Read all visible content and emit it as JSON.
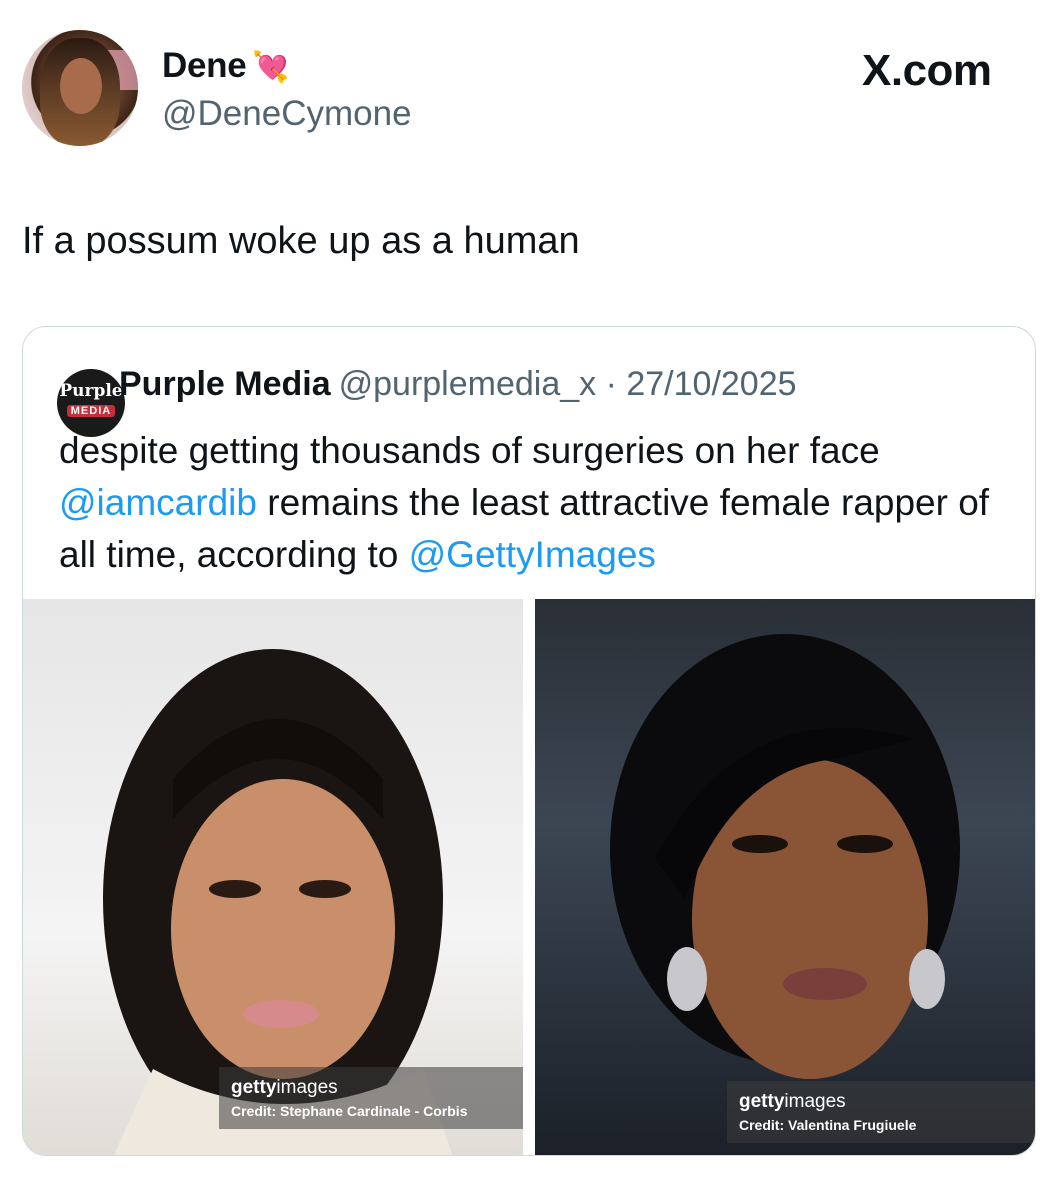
{
  "tweet": {
    "author_name": "Dene",
    "author_emoji": "💘",
    "author_handle": "@DeneCymone",
    "site_logo": "X.com",
    "text": "If a possum woke up as a human"
  },
  "quote": {
    "logo_line1": "Purple",
    "logo_line2": "MEDIA",
    "name": "Purple Media",
    "handle_date": "@purplemedia_x · 27/10/2025",
    "text_1": "despite getting thousands of surgeries on her face",
    "mention_1": "@iamcardib",
    "text_2": " remains the least attractive female rapper of all time, according to ",
    "mention_2": "@GettyImages",
    "photos": [
      {
        "brand_bold": "getty",
        "brand_light": "images",
        "credit": "Credit: Stephane Cardinale - Corbis"
      },
      {
        "brand_bold": "getty",
        "brand_light": "images",
        "credit": "Credit: Valentina Frugiuele"
      }
    ]
  }
}
